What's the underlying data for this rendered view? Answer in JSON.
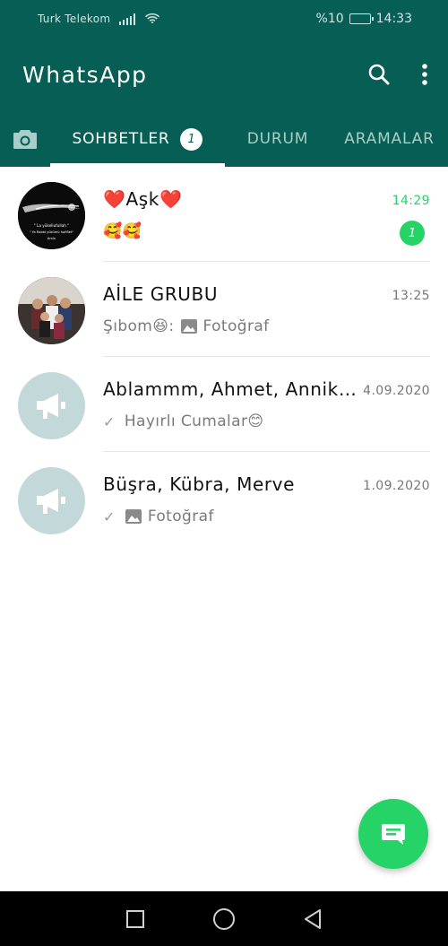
{
  "status_bar": {
    "carrier": "Turk Telekom",
    "battery_text": "%10",
    "time": "14:33",
    "battery_level": 0.1
  },
  "app_bar": {
    "title": "WhatsApp",
    "icons": [
      "search-icon",
      "more-vert-icon"
    ]
  },
  "tabs": {
    "camera_icon": "camera-icon",
    "items": [
      {
        "label": "SOHBETLER",
        "badge": "1",
        "active": true
      },
      {
        "label": "DURUM"
      },
      {
        "label": "ARAMALAR"
      }
    ]
  },
  "chats": [
    {
      "name": "❤️Aşk❤️",
      "time": "14:29",
      "preview": "🥰🥰",
      "unread_count": "1",
      "avatar_text": [
        "\" La yükellufullah \"",
        "\" Ya Rabbi yükümü hafiflet\"",
        "Amin"
      ]
    },
    {
      "name": "AİLE GRUBU",
      "time": "13:25",
      "preview_sender": "Şıbom😆:",
      "preview": "Fotoğraf"
    },
    {
      "name": "Ablammm, Ahmet, Annik, ...",
      "time": "4.09.2020",
      "preview": "Hayırlı Cumalar😊"
    },
    {
      "name": "Büşra, Kübra, Merve",
      "time": "1.09.2020",
      "preview": "Fotoğraf"
    }
  ],
  "colors": {
    "header": "#075e54",
    "accent": "#25d366",
    "group_avatar": "#c3d9d9"
  }
}
